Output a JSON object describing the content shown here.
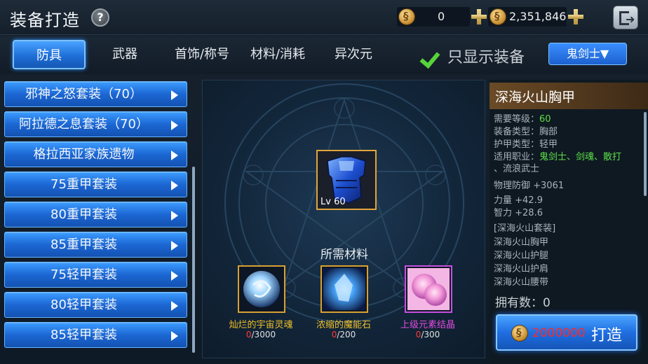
{
  "header": {
    "title": "装备打造",
    "help_icon": "question-icon",
    "currency_a": {
      "icon": "coin-icon",
      "value": "0"
    },
    "currency_b": {
      "icon": "locked-coin-icon",
      "value": "2,351,846"
    },
    "exit_icon": "exit-door-icon"
  },
  "tabs": [
    {
      "label": "防具",
      "active": true
    },
    {
      "label": "武器",
      "active": false
    },
    {
      "label": "首饰/称号",
      "active": false
    },
    {
      "label": "材料/消耗",
      "active": false
    },
    {
      "label": "异次元",
      "active": false
    }
  ],
  "filter": {
    "label": "只显示装备",
    "checked": true
  },
  "class_select": {
    "value": "鬼剑士▼"
  },
  "sets": [
    "邪神之怒套装（70）",
    "阿拉德之息套装（70）",
    "格拉西亚家族遗物",
    "75重甲套装",
    "80重甲套装",
    "85重甲套装",
    "75轻甲套装",
    "80轻甲套装",
    "85轻甲套装"
  ],
  "item": {
    "level_text": "Lv 60"
  },
  "materials_title": "所需材料",
  "materials": [
    {
      "name": "灿烂的宇宙灵魂",
      "have": "0",
      "need": "/3000",
      "color": "#f1c12a"
    },
    {
      "name": "浓缩的魔能石",
      "have": "0",
      "need": "/200",
      "color": "#f1c12a"
    },
    {
      "name": "上级元素结晶",
      "have": "0",
      "need": "/300",
      "color": "#e04be0"
    }
  ],
  "detail": {
    "name": "深海火山胸甲",
    "req_level_label": "需要等级：",
    "req_level": "60",
    "type_label": "装备类型：",
    "type": "胸部",
    "armor_label": "护甲类型：",
    "armor": "轻甲",
    "job_label": "适用职业：",
    "job": "鬼剑士、剑魂、散打",
    "job2": "、流浪武士",
    "defense": "物理防御 +3061",
    "str": "力量 +42.9",
    "int": "智力 +28.6",
    "set_name": "[深海火山套装]",
    "set_items": [
      "深海火山胸甲",
      "深海火山护腿",
      "深海火山护肩",
      "深海火山腰带"
    ],
    "owned": "拥有数：0"
  },
  "craft": {
    "cost": "2000000",
    "label": "打造"
  }
}
